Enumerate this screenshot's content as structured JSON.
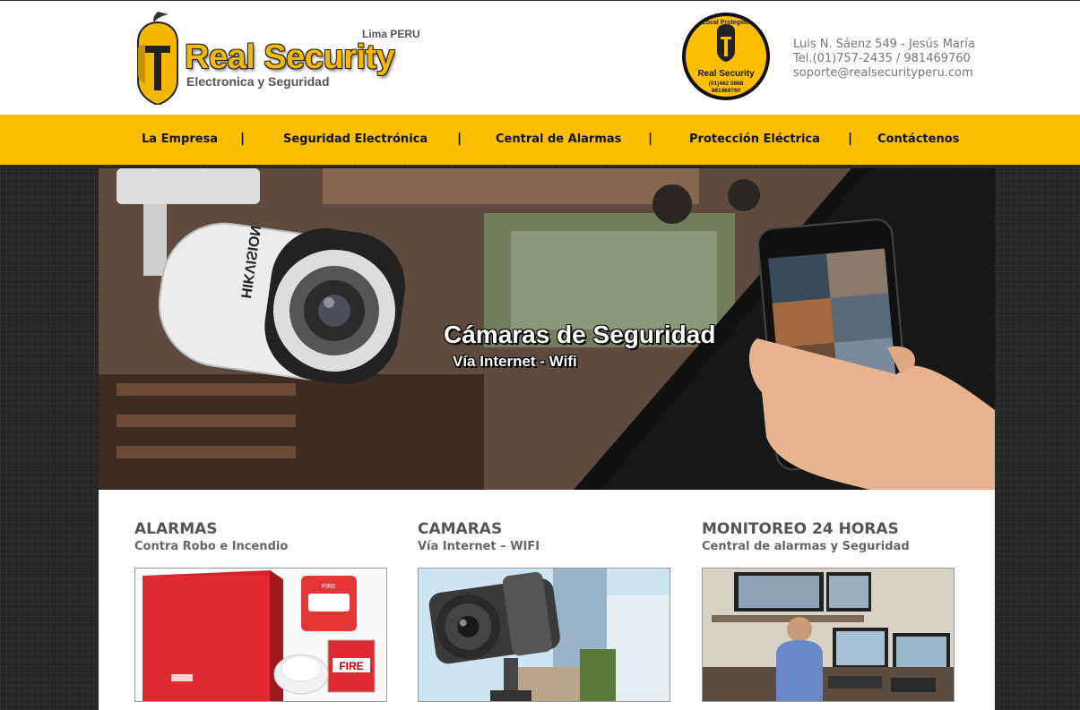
{
  "header": {
    "city": "Lima PERU",
    "brand": "Real Security",
    "tagline": "Electronica y Seguridad",
    "badge": {
      "top_text": "Local Protegido",
      "brand": "Real Security",
      "phones": [
        "(01)462 0868",
        "981469760"
      ]
    },
    "contact": {
      "address": "Luis N. Sáenz 549 - Jesús María",
      "phone": "Tel.(01)757-2435 / 981469760",
      "email": "soporte@realsecurityperu.com"
    }
  },
  "nav": {
    "items": [
      "La Empresa",
      "Seguridad Electrónica",
      "Central de Alarmas",
      "Protección Eléctrica",
      "Contáctenos"
    ],
    "separator": "|"
  },
  "banner": {
    "title": "Cámaras de Seguridad",
    "subtitle": "Vía Internet - Wifi",
    "camera_brand": "HIKVISION"
  },
  "services": [
    {
      "title": "ALARMAS",
      "subtitle": "Contra Robo e Incendio",
      "image_text": [
        "FIRE",
        "FIRE"
      ]
    },
    {
      "title": "CAMARAS",
      "subtitle": "Vía Internet – WIFI"
    },
    {
      "title": "MONITOREO 24 HORAS",
      "subtitle": "Central de alarmas y Seguridad"
    }
  ],
  "colors": {
    "accent": "#fcbf00",
    "brand_yellow": "#f5b800",
    "text_dark": "#111111",
    "text_gray": "#555555"
  }
}
